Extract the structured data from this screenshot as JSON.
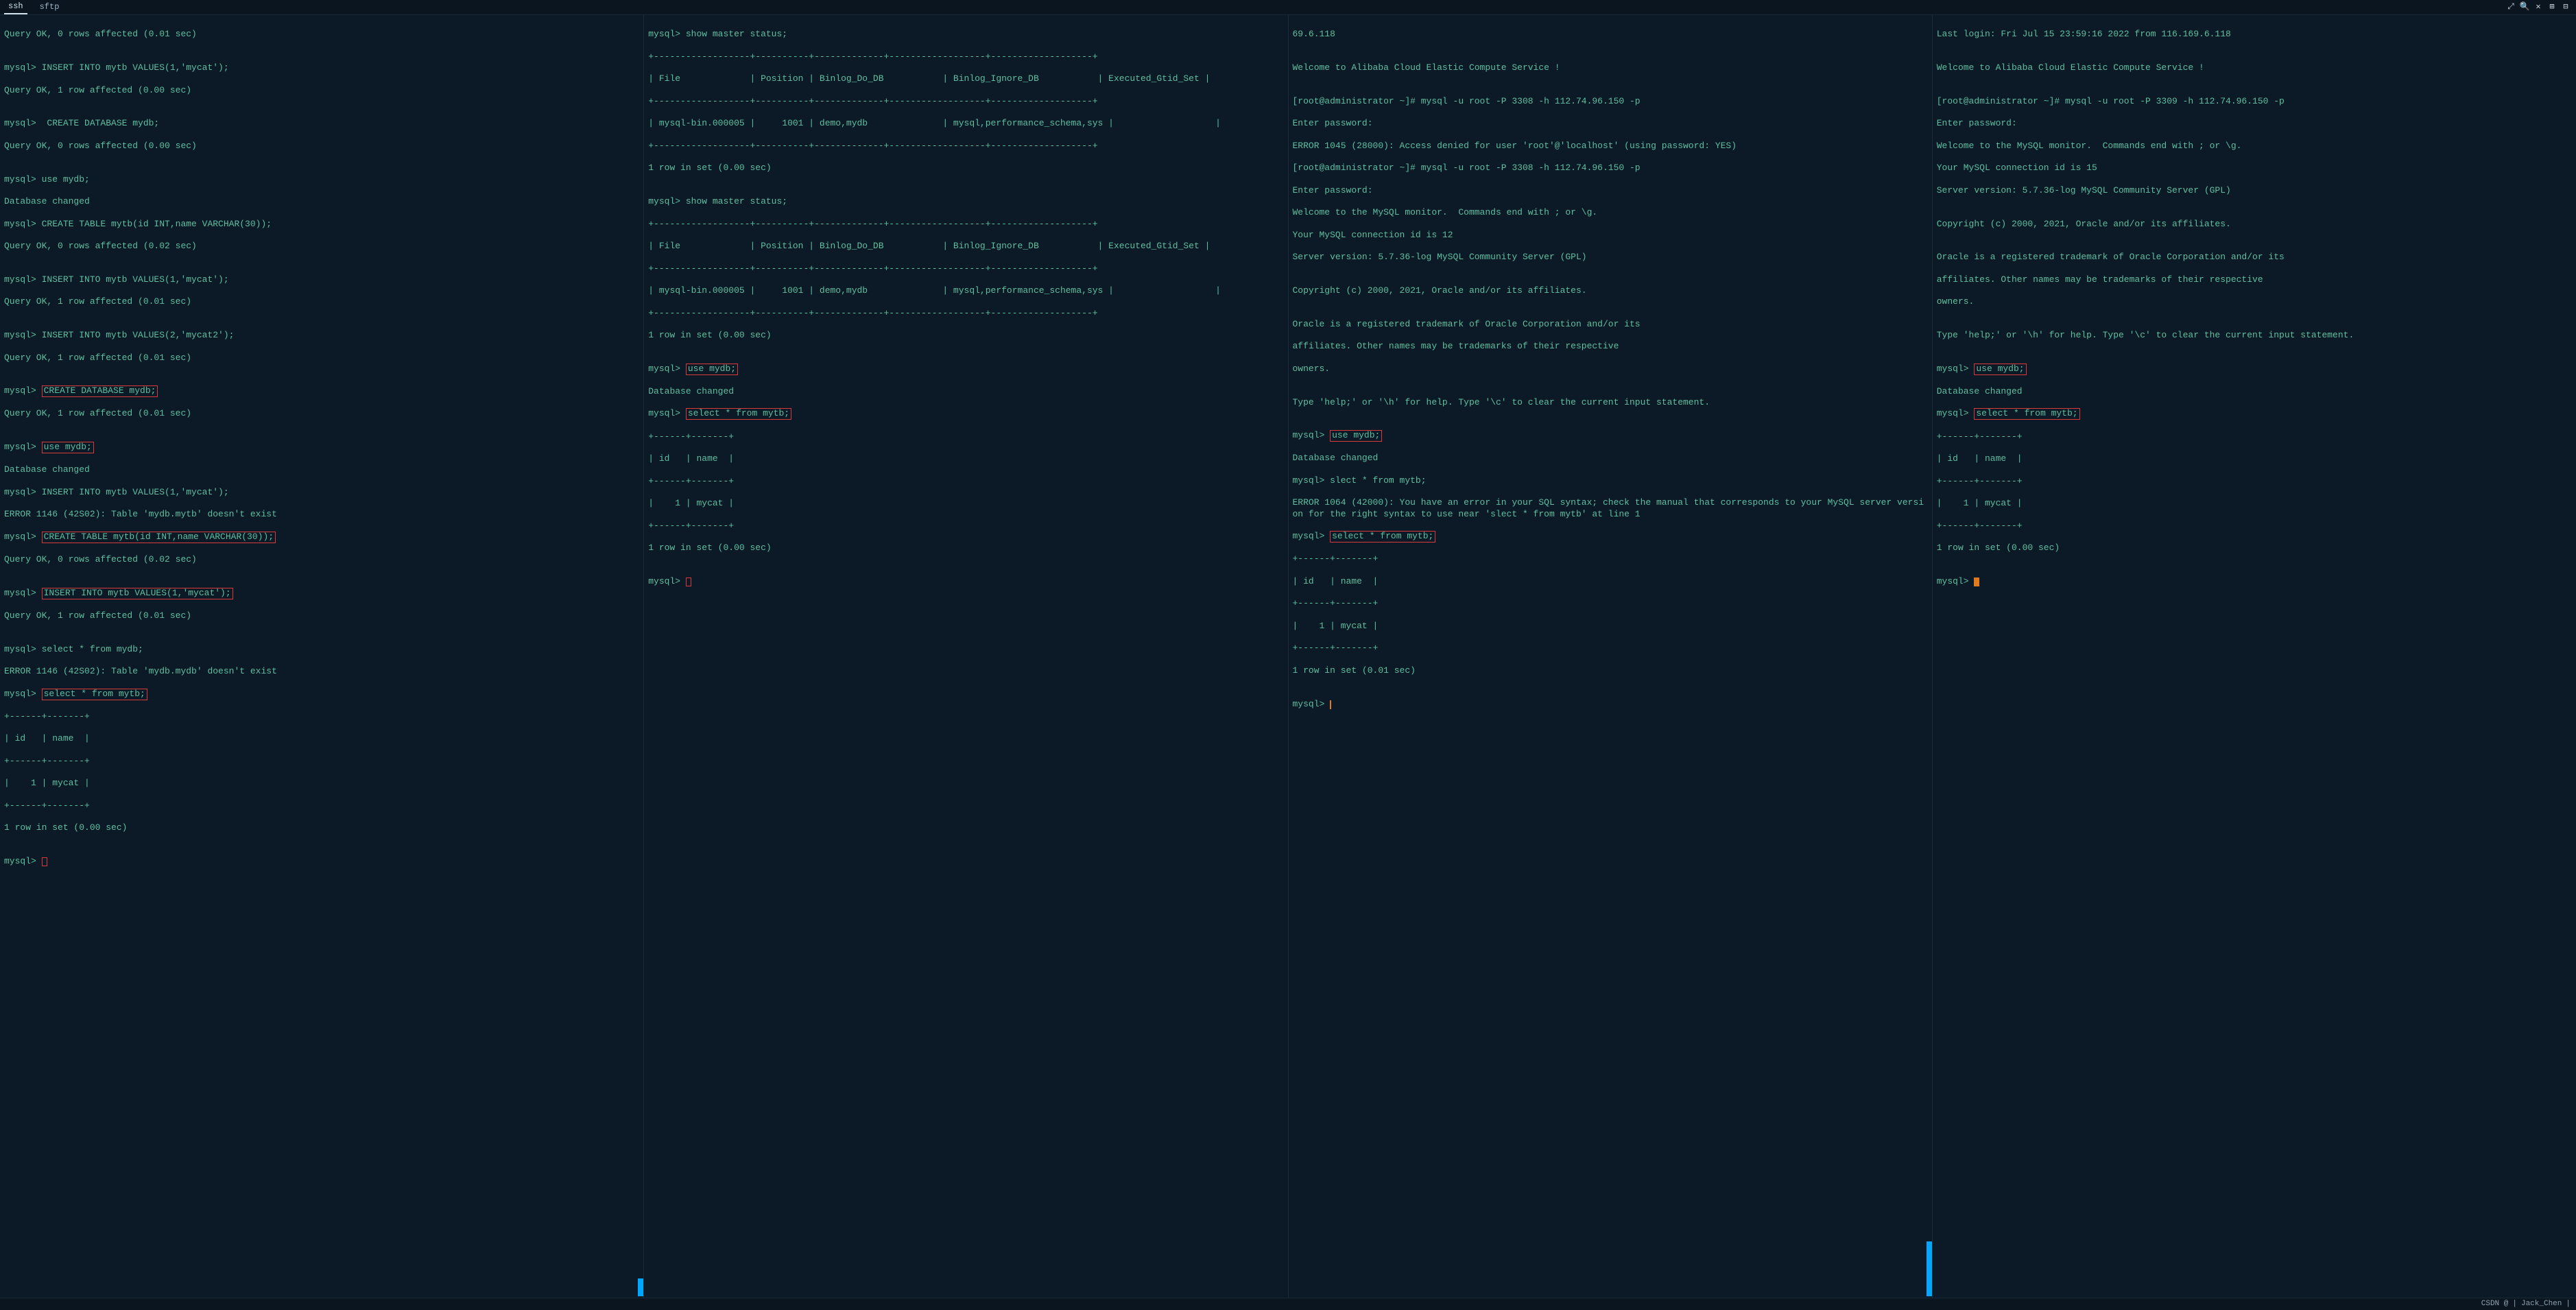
{
  "tabs": {
    "ssh": "ssh",
    "sftp": "sftp"
  },
  "titlebar": {
    "expand": "⤢",
    "search": "🔍",
    "close": "✕",
    "split1": "⊞",
    "split2": "⊟"
  },
  "pane1": {
    "l01": "Query OK, 0 rows affected (0.01 sec)",
    "l02": "",
    "l03": "mysql> INSERT INTO mytb VALUES(1,'mycat');",
    "l04": "Query OK, 1 row affected (0.00 sec)",
    "l05": "",
    "l06": "mysql>  CREATE DATABASE mydb;",
    "l07": "Query OK, 0 rows affected (0.00 sec)",
    "l08": "",
    "l09": "mysql> use mydb;",
    "l10": "Database changed",
    "l11": "mysql> CREATE TABLE mytb(id INT,name VARCHAR(30));",
    "l12": "Query OK, 0 rows affected (0.02 sec)",
    "l13": "",
    "l14": "mysql> INSERT INTO mytb VALUES(1,'mycat');",
    "l15": "Query OK, 1 row affected (0.01 sec)",
    "l16": "",
    "l17": "mysql> INSERT INTO mytb VALUES(2,'mycat2');",
    "l18": "Query OK, 1 row affected (0.01 sec)",
    "l19": "",
    "l20p": "mysql> ",
    "l20h": "CREATE DATABASE mydb;",
    "l21": "Query OK, 1 row affected (0.01 sec)",
    "l22": "",
    "l23p": "mysql> ",
    "l23h": "use mydb;",
    "l24": "Database changed",
    "l25": "mysql> INSERT INTO mytb VALUES(1,'mycat');",
    "l26": "ERROR 1146 (42S02): Table 'mydb.mytb' doesn't exist",
    "l27p": "mysql> ",
    "l27h": "CREATE TABLE mytb(id INT,name VARCHAR(30));",
    "l28": "Query OK, 0 rows affected (0.02 sec)",
    "l29": "",
    "l30p": "mysql> ",
    "l30h": "INSERT INTO mytb VALUES(1,'mycat');",
    "l31": "Query OK, 1 row affected (0.01 sec)",
    "l32": "",
    "l33": "mysql> select * from mydb;",
    "l34": "ERROR 1146 (42S02): Table 'mydb.mydb' doesn't exist",
    "l35p": "mysql> ",
    "l35h": "select * from mytb;",
    "l36": "+------+-------+",
    "l37": "| id   | name  |",
    "l38": "+------+-------+",
    "l39": "|    1 | mycat |",
    "l40": "+------+-------+",
    "l41": "1 row in set (0.00 sec)",
    "l42": "",
    "l43": "mysql> "
  },
  "pane2": {
    "l01": "mysql> show master status;",
    "l02": "+------------------+----------+-------------+------------------+-------------------+",
    "l03": "| File             | Position | Binlog_Do_DB           | Binlog_Ignore_DB           | Executed_Gtid_Set |",
    "l04": "+------------------+----------+-------------+------------------+-------------------+",
    "l05": "| mysql-bin.000005 |     1001 | demo,mydb              | mysql,performance_schema,sys |                   |",
    "l06": "+------------------+----------+-------------+------------------+-------------------+",
    "l07": "1 row in set (0.00 sec)",
    "l08": "",
    "l09": "mysql> show master status;",
    "l10": "+------------------+----------+-------------+------------------+-------------------+",
    "l11": "| File             | Position | Binlog_Do_DB           | Binlog_Ignore_DB           | Executed_Gtid_Set |",
    "l12": "+------------------+----------+-------------+------------------+-------------------+",
    "l13": "| mysql-bin.000005 |     1001 | demo,mydb              | mysql,performance_schema,sys |                   |",
    "l14": "+------------------+----------+-------------+------------------+-------------------+",
    "l15": "1 row in set (0.00 sec)",
    "l16": "",
    "l17p": "mysql> ",
    "l17h": "use mydb;",
    "l18": "Database changed",
    "l19p": "mysql> ",
    "l19h": "select * from mytb;",
    "l20": "+------+-------+",
    "l21": "| id   | name  |",
    "l22": "+------+-------+",
    "l23": "|    1 | mycat |",
    "l24": "+------+-------+",
    "l25": "1 row in set (0.00 sec)",
    "l26": "",
    "l27": "mysql> "
  },
  "pane3": {
    "l01": "69.6.118",
    "l02": "",
    "l03": "Welcome to Alibaba Cloud Elastic Compute Service !",
    "l04": "",
    "l05": "[root@administrator ~]# mysql -u root -P 3308 -h 112.74.96.150 -p",
    "l06": "Enter password:",
    "l07": "ERROR 1045 (28000): Access denied for user 'root'@'localhost' (using password: YES)",
    "l08": "[root@administrator ~]# mysql -u root -P 3308 -h 112.74.96.150 -p",
    "l09": "Enter password:",
    "l10": "Welcome to the MySQL monitor.  Commands end with ; or \\g.",
    "l11": "Your MySQL connection id is 12",
    "l12": "Server version: 5.7.36-log MySQL Community Server (GPL)",
    "l13": "",
    "l14": "Copyright (c) 2000, 2021, Oracle and/or its affiliates.",
    "l15": "",
    "l16": "Oracle is a registered trademark of Oracle Corporation and/or its",
    "l17": "affiliates. Other names may be trademarks of their respective",
    "l18": "owners.",
    "l19": "",
    "l20": "Type 'help;' or '\\h' for help. Type '\\c' to clear the current input statement.",
    "l21": "",
    "l22p": "mysql> ",
    "l22h": "use mydb;",
    "l23": "Database changed",
    "l24": "mysql> slect * from mytb;",
    "l25": "ERROR 1064 (42000): You have an error in your SQL syntax; check the manual that corresponds to your MySQL server version for the right syntax to use near 'slect * from mytb' at line 1",
    "l26p": "mysql> ",
    "l26h": "select * from mytb;",
    "l27": "+------+-------+",
    "l28": "| id   | name  |",
    "l29": "+------+-------+",
    "l30": "|    1 | mycat |",
    "l31": "+------+-------+",
    "l32": "1 row in set (0.01 sec)",
    "l33": "",
    "l34": "mysql> "
  },
  "pane4": {
    "l01": "Last login: Fri Jul 15 23:59:16 2022 from 116.169.6.118",
    "l02": "",
    "l03": "Welcome to Alibaba Cloud Elastic Compute Service !",
    "l04": "",
    "l05": "[root@administrator ~]# mysql -u root -P 3309 -h 112.74.96.150 -p",
    "l06": "Enter password:",
    "l07": "Welcome to the MySQL monitor.  Commands end with ; or \\g.",
    "l08": "Your MySQL connection id is 15",
    "l09": "Server version: 5.7.36-log MySQL Community Server (GPL)",
    "l10": "",
    "l11": "Copyright (c) 2000, 2021, Oracle and/or its affiliates.",
    "l12": "",
    "l13": "Oracle is a registered trademark of Oracle Corporation and/or its",
    "l14": "affiliates. Other names may be trademarks of their respective",
    "l15": "owners.",
    "l16": "",
    "l17": "Type 'help;' or '\\h' for help. Type '\\c' to clear the current input statement.",
    "l18": "",
    "l19p": "mysql> ",
    "l19h": "use mydb;",
    "l20": "Database changed",
    "l21p": "mysql> ",
    "l21h": "select * from mytb;",
    "l22": "+------+-------+",
    "l23": "| id   | name  |",
    "l24": "+------+-------+",
    "l25": "|    1 | mycat |",
    "l26": "+------+-------+",
    "l27": "1 row in set (0.00 sec)",
    "l28": "",
    "l29": "mysql> "
  },
  "status": {
    "csdn": "CSDN @",
    "divider": "|",
    "author": "Jack_Chen",
    "trail": "|"
  }
}
